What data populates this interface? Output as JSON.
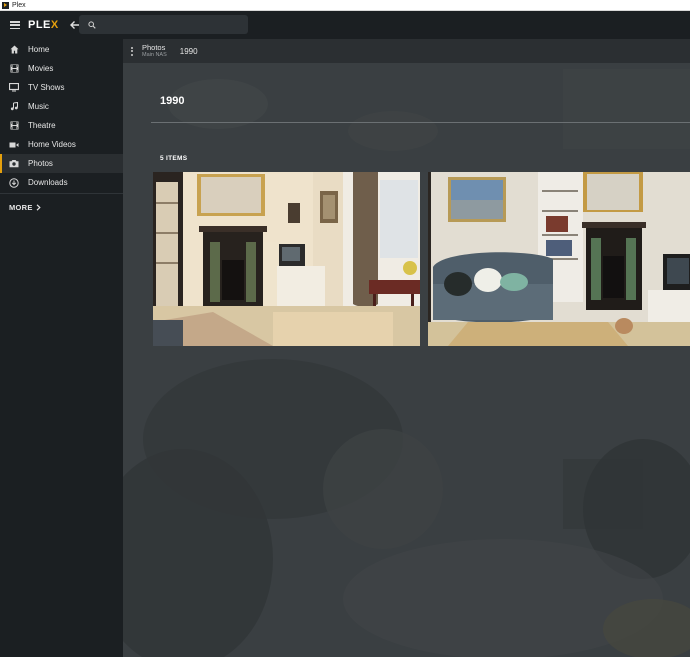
{
  "window": {
    "title": "Plex"
  },
  "topbar": {
    "logo_main": "PLE",
    "logo_accent": "X",
    "search_placeholder": ""
  },
  "sidebar": {
    "items": [
      {
        "label": "Home",
        "icon": "home-icon"
      },
      {
        "label": "Movies",
        "icon": "film-icon"
      },
      {
        "label": "TV Shows",
        "icon": "tv-icon"
      },
      {
        "label": "Music",
        "icon": "music-note-icon"
      },
      {
        "label": "Theatre",
        "icon": "film-icon"
      },
      {
        "label": "Home Videos",
        "icon": "video-camera-icon"
      },
      {
        "label": "Photos",
        "icon": "camera-icon",
        "active": true
      },
      {
        "label": "Downloads",
        "icon": "download-icon"
      }
    ],
    "more_label": "MORE"
  },
  "breadcrumb": {
    "library": "Photos",
    "server": "Main NAS",
    "current": "1990"
  },
  "main": {
    "title": "1990",
    "item_count": "5 ITEMS"
  },
  "colors": {
    "accent": "#e5a00d",
    "sidebar_bg": "#1b1f22",
    "main_bg": "#3b4043"
  }
}
